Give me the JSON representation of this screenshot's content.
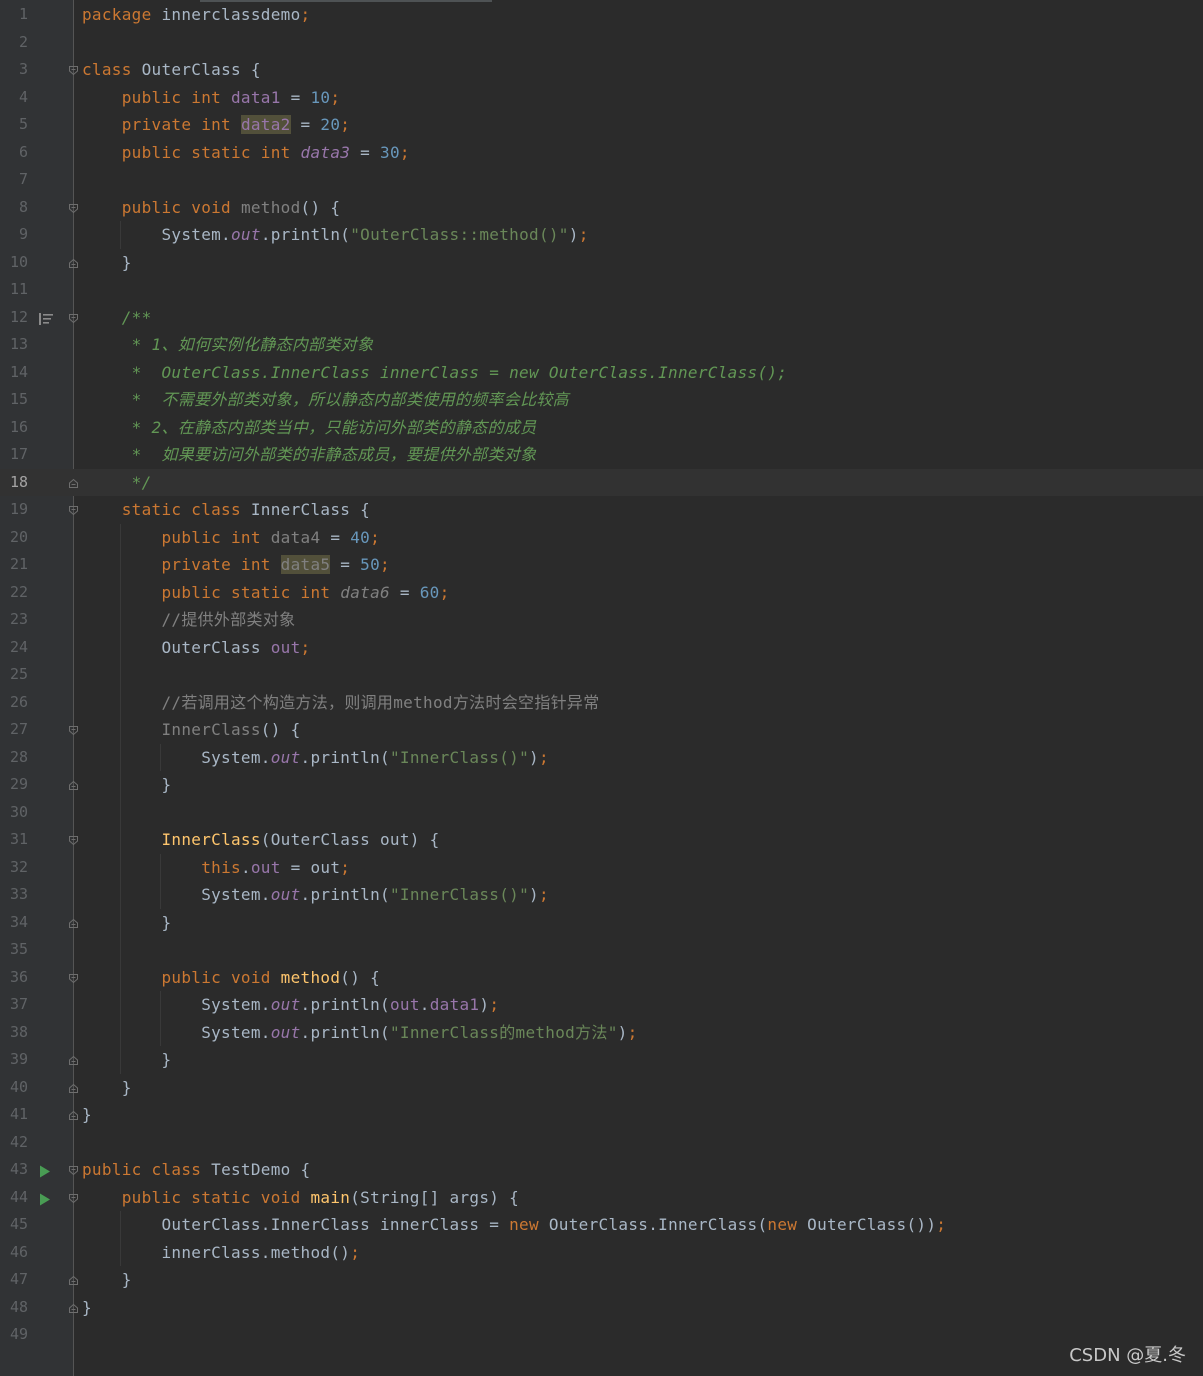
{
  "editor": {
    "lines": [
      {
        "n": "1",
        "tokens": [
          [
            "kw",
            "package"
          ],
          [
            "p",
            " innerclassdemo"
          ],
          [
            "kw",
            ";"
          ]
        ]
      },
      {
        "n": "2",
        "tokens": []
      },
      {
        "n": "3",
        "tokens": [
          [
            "kw",
            "class"
          ],
          [
            "p",
            " OuterClass {"
          ]
        ]
      },
      {
        "n": "4",
        "tokens": [
          [
            "p",
            "    "
          ],
          [
            "kw",
            "public int"
          ],
          [
            "p",
            " "
          ],
          [
            "fld",
            "data1"
          ],
          [
            "p",
            " = "
          ],
          [
            "num",
            "10"
          ],
          [
            "kw",
            ";"
          ]
        ]
      },
      {
        "n": "5",
        "tokens": [
          [
            "p",
            "    "
          ],
          [
            "kw",
            "private int"
          ],
          [
            "p",
            " "
          ],
          [
            "fldhl",
            "data2"
          ],
          [
            "p",
            " = "
          ],
          [
            "num",
            "20"
          ],
          [
            "kw",
            ";"
          ]
        ]
      },
      {
        "n": "6",
        "tokens": [
          [
            "p",
            "    "
          ],
          [
            "kw",
            "public static int"
          ],
          [
            "p",
            " "
          ],
          [
            "st",
            "data3"
          ],
          [
            "p",
            " = "
          ],
          [
            "num",
            "30"
          ],
          [
            "kw",
            ";"
          ]
        ]
      },
      {
        "n": "7",
        "tokens": []
      },
      {
        "n": "8",
        "tokens": [
          [
            "p",
            "    "
          ],
          [
            "kw",
            "public void"
          ],
          [
            "p",
            " "
          ],
          [
            "unused",
            "method"
          ],
          [
            "p",
            "() {"
          ]
        ]
      },
      {
        "n": "9",
        "tokens": [
          [
            "p",
            "        System."
          ],
          [
            "st",
            "out"
          ],
          [
            "p",
            ".println("
          ],
          [
            "str",
            "\"OuterClass::method()\""
          ],
          [
            "p",
            ")"
          ],
          [
            "kw",
            ";"
          ]
        ]
      },
      {
        "n": "10",
        "tokens": [
          [
            "p",
            "    }"
          ]
        ]
      },
      {
        "n": "11",
        "tokens": []
      },
      {
        "n": "12",
        "tokens": [
          [
            "p",
            "    "
          ],
          [
            "cm",
            "/**"
          ]
        ]
      },
      {
        "n": "13",
        "tokens": [
          [
            "p",
            "     "
          ],
          [
            "cm",
            "* 1、如何实例化静态内部类对象"
          ]
        ]
      },
      {
        "n": "14",
        "tokens": [
          [
            "p",
            "     "
          ],
          [
            "cm",
            "*  OuterClass.InnerClass innerClass = new OuterClass.InnerClass();"
          ]
        ]
      },
      {
        "n": "15",
        "tokens": [
          [
            "p",
            "     "
          ],
          [
            "cm",
            "*  不需要外部类对象，所以静态内部类使用的频率会比较高"
          ]
        ]
      },
      {
        "n": "16",
        "tokens": [
          [
            "p",
            "     "
          ],
          [
            "cm",
            "* 2、在静态内部类当中，只能访问外部类的静态的成员"
          ]
        ]
      },
      {
        "n": "17",
        "tokens": [
          [
            "p",
            "     "
          ],
          [
            "cm",
            "*  如果要访问外部类的非静态成员，要提供外部类对象"
          ]
        ]
      },
      {
        "n": "18",
        "tokens": [
          [
            "p",
            "     "
          ],
          [
            "cm",
            "*/"
          ]
        ]
      },
      {
        "n": "19",
        "tokens": [
          [
            "p",
            "    "
          ],
          [
            "kw",
            "static class"
          ],
          [
            "p",
            " InnerClass {"
          ]
        ]
      },
      {
        "n": "20",
        "tokens": [
          [
            "p",
            "        "
          ],
          [
            "kw",
            "public int"
          ],
          [
            "p",
            " "
          ],
          [
            "unused",
            "data4"
          ],
          [
            "p",
            " = "
          ],
          [
            "num",
            "40"
          ],
          [
            "kw",
            ";"
          ]
        ]
      },
      {
        "n": "21",
        "tokens": [
          [
            "p",
            "        "
          ],
          [
            "kw",
            "private int"
          ],
          [
            "p",
            " "
          ],
          [
            "unusedhl",
            "data5"
          ],
          [
            "p",
            " = "
          ],
          [
            "num",
            "50"
          ],
          [
            "kw",
            ";"
          ]
        ]
      },
      {
        "n": "22",
        "tokens": [
          [
            "p",
            "        "
          ],
          [
            "kw",
            "public static int"
          ],
          [
            "p",
            " "
          ],
          [
            "unusedit",
            "data6"
          ],
          [
            "p",
            " = "
          ],
          [
            "num",
            "60"
          ],
          [
            "kw",
            ";"
          ]
        ]
      },
      {
        "n": "23",
        "tokens": [
          [
            "p",
            "        "
          ],
          [
            "lc",
            "//提供外部类对象"
          ]
        ]
      },
      {
        "n": "24",
        "tokens": [
          [
            "p",
            "        OuterClass "
          ],
          [
            "fld",
            "out"
          ],
          [
            "kw",
            ";"
          ]
        ]
      },
      {
        "n": "25",
        "tokens": []
      },
      {
        "n": "26",
        "tokens": [
          [
            "p",
            "        "
          ],
          [
            "lc",
            "//若调用这个构造方法，则调用method方法时会空指针异常"
          ]
        ]
      },
      {
        "n": "27",
        "tokens": [
          [
            "p",
            "        "
          ],
          [
            "unused",
            "InnerClass"
          ],
          [
            "p",
            "() {"
          ]
        ]
      },
      {
        "n": "28",
        "tokens": [
          [
            "p",
            "            System."
          ],
          [
            "st",
            "out"
          ],
          [
            "p",
            ".println("
          ],
          [
            "str",
            "\"InnerClass()\""
          ],
          [
            "p",
            ")"
          ],
          [
            "kw",
            ";"
          ]
        ]
      },
      {
        "n": "29",
        "tokens": [
          [
            "p",
            "        }"
          ]
        ]
      },
      {
        "n": "30",
        "tokens": []
      },
      {
        "n": "31",
        "tokens": [
          [
            "p",
            "        "
          ],
          [
            "mth",
            "InnerClass"
          ],
          [
            "p",
            "(OuterClass out) {"
          ]
        ]
      },
      {
        "n": "32",
        "tokens": [
          [
            "p",
            "            "
          ],
          [
            "kw",
            "this"
          ],
          [
            "p",
            "."
          ],
          [
            "fld",
            "out"
          ],
          [
            "p",
            " = out"
          ],
          [
            "kw",
            ";"
          ]
        ]
      },
      {
        "n": "33",
        "tokens": [
          [
            "p",
            "            System."
          ],
          [
            "st",
            "out"
          ],
          [
            "p",
            ".println("
          ],
          [
            "str",
            "\"InnerClass()\""
          ],
          [
            "p",
            ")"
          ],
          [
            "kw",
            ";"
          ]
        ]
      },
      {
        "n": "34",
        "tokens": [
          [
            "p",
            "        }"
          ]
        ]
      },
      {
        "n": "35",
        "tokens": []
      },
      {
        "n": "36",
        "tokens": [
          [
            "p",
            "        "
          ],
          [
            "kw",
            "public void"
          ],
          [
            "p",
            " "
          ],
          [
            "mth",
            "method"
          ],
          [
            "p",
            "() {"
          ]
        ]
      },
      {
        "n": "37",
        "tokens": [
          [
            "p",
            "            System."
          ],
          [
            "st",
            "out"
          ],
          [
            "p",
            ".println("
          ],
          [
            "fld",
            "out"
          ],
          [
            "p",
            "."
          ],
          [
            "fld",
            "data1"
          ],
          [
            "p",
            ")"
          ],
          [
            "kw",
            ";"
          ]
        ]
      },
      {
        "n": "38",
        "tokens": [
          [
            "p",
            "            System."
          ],
          [
            "st",
            "out"
          ],
          [
            "p",
            ".println("
          ],
          [
            "str",
            "\"InnerClass的method方法\""
          ],
          [
            "p",
            ")"
          ],
          [
            "kw",
            ";"
          ]
        ]
      },
      {
        "n": "39",
        "tokens": [
          [
            "p",
            "        }"
          ]
        ]
      },
      {
        "n": "40",
        "tokens": [
          [
            "p",
            "    }"
          ]
        ]
      },
      {
        "n": "41",
        "tokens": [
          [
            "p",
            "}"
          ]
        ]
      },
      {
        "n": "42",
        "tokens": []
      },
      {
        "n": "43",
        "tokens": [
          [
            "kw",
            "public class"
          ],
          [
            "p",
            " TestDemo {"
          ]
        ]
      },
      {
        "n": "44",
        "tokens": [
          [
            "p",
            "    "
          ],
          [
            "kw",
            "public static void"
          ],
          [
            "p",
            " "
          ],
          [
            "mth",
            "main"
          ],
          [
            "p",
            "(String[] args) {"
          ]
        ]
      },
      {
        "n": "45",
        "tokens": [
          [
            "p",
            "        OuterClass.InnerClass innerClass = "
          ],
          [
            "kw",
            "new"
          ],
          [
            "p",
            " OuterClass.InnerClass("
          ],
          [
            "kw",
            "new"
          ],
          [
            "p",
            " OuterClass())"
          ],
          [
            "kw",
            ";"
          ]
        ]
      },
      {
        "n": "46",
        "tokens": [
          [
            "p",
            "        innerClass.method()"
          ],
          [
            "kw",
            ";"
          ]
        ]
      },
      {
        "n": "47",
        "tokens": [
          [
            "p",
            "    }"
          ]
        ]
      },
      {
        "n": "48",
        "tokens": [
          [
            "p",
            "}"
          ]
        ]
      },
      {
        "n": "49",
        "tokens": []
      }
    ],
    "current_line": "18",
    "folds_open": [
      "3",
      "8",
      "12",
      "19",
      "27",
      "31",
      "36",
      "43",
      "44"
    ],
    "folds_close": [
      "10",
      "18",
      "29",
      "34",
      "39",
      "40",
      "41",
      "47",
      "48"
    ],
    "run_markers": [
      "43",
      "44"
    ],
    "bookmark_lines": [
      "12"
    ]
  },
  "watermark": "CSDN @夏.冬",
  "colors": {
    "background": "#2b2b2b",
    "gutter": "#313335",
    "keyword": "#cc7832",
    "number": "#6897bb",
    "string": "#6a8759",
    "field": "#9876aa",
    "method": "#ffc66d",
    "doc_comment": "#629755",
    "line_comment": "#808080",
    "run": "#499c54"
  }
}
